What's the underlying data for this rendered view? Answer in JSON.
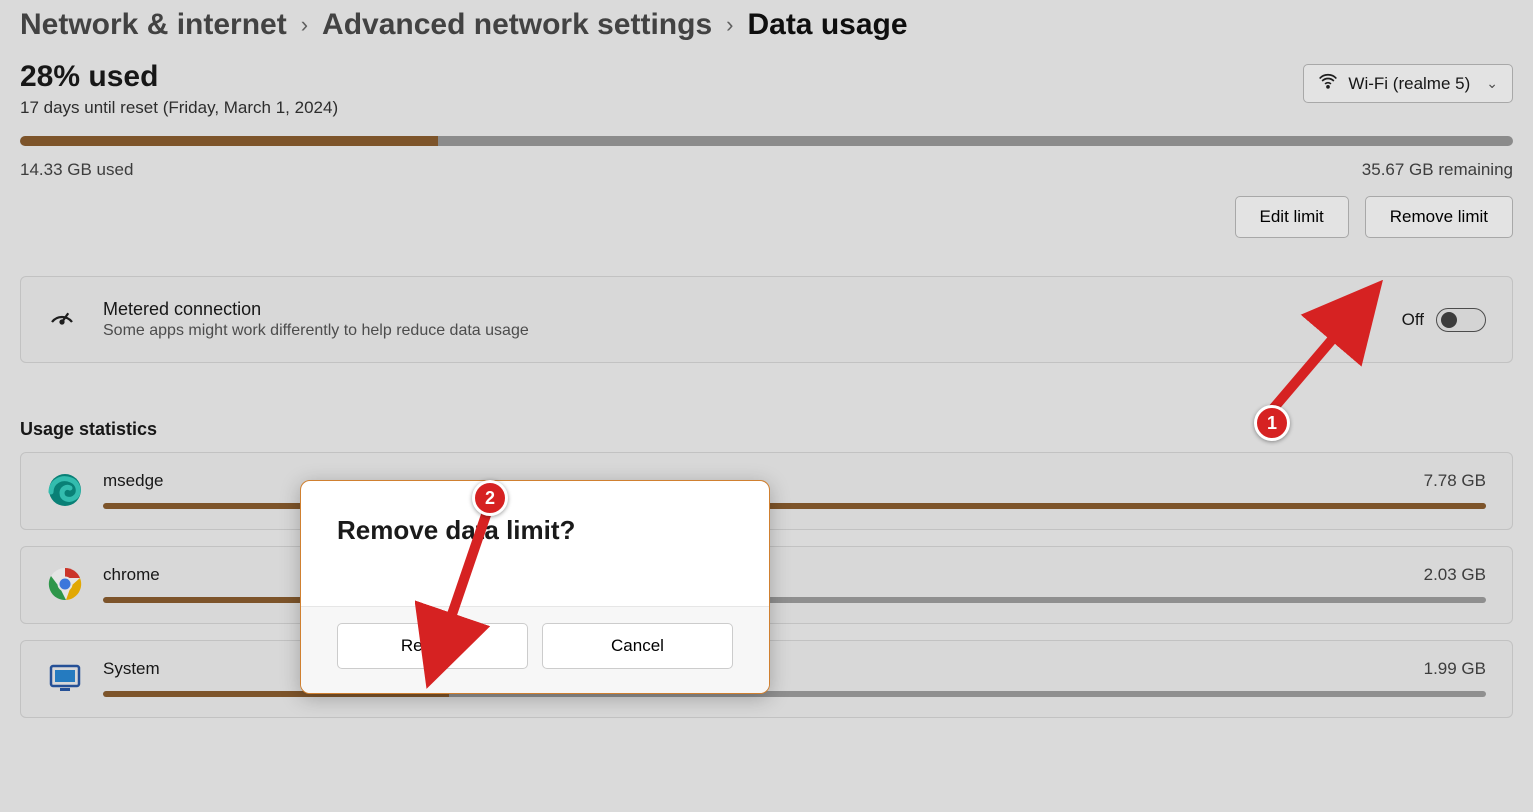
{
  "breadcrumb": {
    "root": "Network & internet",
    "mid": "Advanced network settings",
    "current": "Data usage"
  },
  "usage": {
    "percent_label": "28% used",
    "reset_label": "17 days until reset (Friday, March 1, 2024)",
    "used_label": "14.33 GB used",
    "remaining_label": "35.67 GB remaining",
    "progress_percent": 28
  },
  "network_selector": {
    "label": "Wi-Fi (realme 5)"
  },
  "buttons": {
    "edit_limit": "Edit limit",
    "remove_limit": "Remove limit"
  },
  "metered": {
    "title": "Metered connection",
    "subtitle": "Some apps might work differently to help reduce data usage",
    "state_label": "Off"
  },
  "stats": {
    "heading": "Usage statistics",
    "apps": [
      {
        "name": "msedge",
        "usage": "7.78 GB",
        "percent": 100
      },
      {
        "name": "chrome",
        "usage": "2.03 GB",
        "percent": 26
      },
      {
        "name": "System",
        "usage": "1.99 GB",
        "percent": 25
      }
    ]
  },
  "dialog": {
    "title": "Remove data limit?",
    "remove": "Remove",
    "cancel": "Cancel"
  },
  "annotations": {
    "one": "1",
    "two": "2"
  }
}
